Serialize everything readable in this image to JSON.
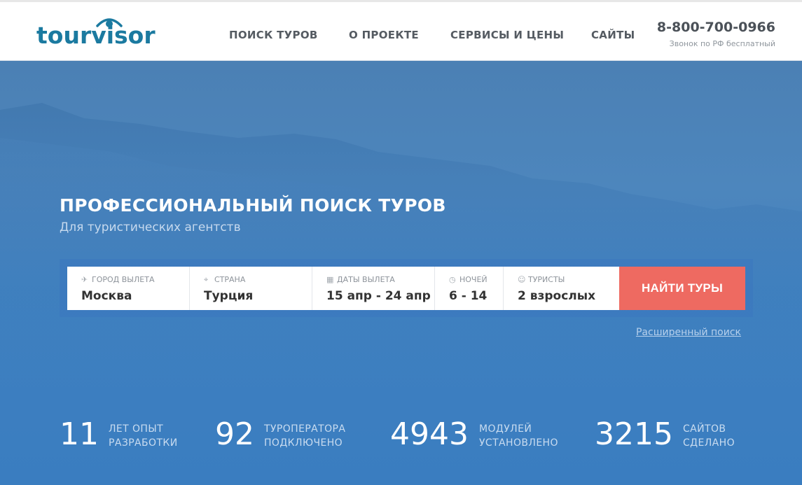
{
  "header": {
    "logo_text": "tourvisor",
    "nav": [
      "ПОИСК ТУРОВ",
      "О ПРОЕКТЕ",
      "СЕРВИСЫ И ЦЕНЫ",
      "САЙТЫ"
    ],
    "phone": "8-800-700-0966",
    "phone_note": "Звонок по РФ бесплатный"
  },
  "hero": {
    "title": "ПРОФЕССИОНАЛЬНЫЙ ПОИСК ТУРОВ",
    "subtitle": "Для туристических агентств"
  },
  "search": {
    "fields": [
      {
        "label": "ГОРОД ВЫЛЕТА",
        "value": "Москва",
        "icon": "plane-icon"
      },
      {
        "label": "СТРАНА",
        "value": "Турция",
        "icon": "location-pin-icon"
      },
      {
        "label": "ДАТЫ ВЫЛЕТА",
        "value": "15 апр - 24 апр",
        "icon": "calendar-icon"
      },
      {
        "label": "НОЧЕЙ",
        "value": "6 - 14",
        "icon": "clock-icon"
      },
      {
        "label": "ТУРИСТЫ",
        "value": "2 взрослых",
        "icon": "user-icon"
      }
    ],
    "button_label": "НАЙТИ ТУРЫ",
    "advanced_link": "Расширенный поиск"
  },
  "stats": [
    {
      "number": "11",
      "line1": "ЛЕТ ОПЫТ",
      "line2": "РАЗРАБОТКИ"
    },
    {
      "number": "92",
      "line1": "ТУРОПЕРАТОРА",
      "line2": "ПОДКЛЮЧЕНО"
    },
    {
      "number": "4943",
      "line1": "МОДУЛЕЙ",
      "line2": "УСТАНОВЛЕНО"
    },
    {
      "number": "3215",
      "line1": "САЙТОВ",
      "line2": "СДЕЛАНО"
    }
  ],
  "colors": {
    "brand": "#1b7aa0",
    "accent_button": "#ee6a61",
    "hero_blue": "#3f80bf"
  }
}
